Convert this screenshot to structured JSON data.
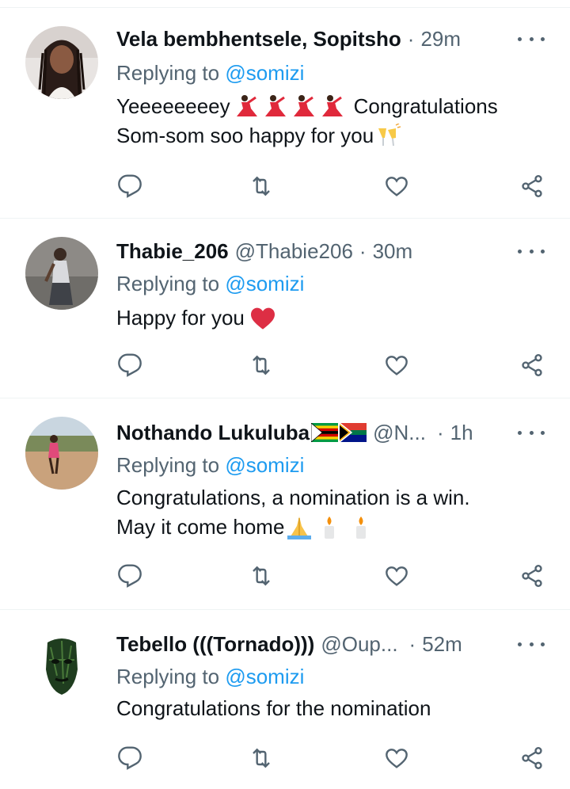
{
  "replying_prefix": "Replying to",
  "tweets": [
    {
      "name": "Vela bembhentsele, Sopitsho",
      "handle": "",
      "dot": "·",
      "time": "29m",
      "reply_to": "@somizi",
      "lines": [
        "Yeeeeeeeey",
        "Congratulations",
        "Som-som soo happy for you"
      ]
    },
    {
      "name": "Thabie_206",
      "handle": "@Thabie206",
      "dot": "·",
      "time": "30m",
      "reply_to": "@somizi",
      "lines": [
        "Happy for you"
      ]
    },
    {
      "name": "Nothando Lukuluba",
      "handle": "@N...",
      "dot": "·",
      "time": "1h",
      "reply_to": "@somizi",
      "lines": [
        "Congratulations, a nomination is a win.",
        "May it come home"
      ]
    },
    {
      "name": "Tebello (((Tornado)))",
      "handle": "@Oup...",
      "dot": "·",
      "time": "52m",
      "reply_to": "@somizi",
      "lines": [
        "Congratulations for the nomination"
      ]
    }
  ],
  "icons": {
    "reply": "reply-icon",
    "retweet": "retweet-icon",
    "like": "heart-icon",
    "share": "share-icon",
    "more": "more-icon"
  },
  "colors": {
    "text": "#0f1419",
    "secondary": "#536471",
    "mention": "#1d9bf0",
    "divider": "#eff3f4"
  }
}
